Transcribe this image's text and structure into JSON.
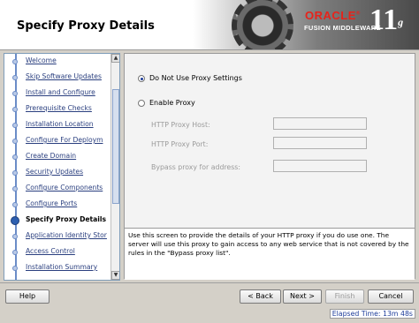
{
  "header": {
    "title": "Specify Proxy Details",
    "brand": "ORACLE",
    "brand_reg": "®",
    "product": "FUSION MIDDLEWARE",
    "version": "11",
    "version_suffix": "g"
  },
  "nav": {
    "items": [
      {
        "label": "Welcome",
        "state": "done"
      },
      {
        "label": "Skip Software Updates",
        "state": "done"
      },
      {
        "label": "Install and Configure",
        "state": "done"
      },
      {
        "label": "Prerequisite Checks",
        "state": "done"
      },
      {
        "label": "Installation Location",
        "state": "done"
      },
      {
        "label": "Configure For Deploym",
        "state": "done"
      },
      {
        "label": "Create Domain",
        "state": "done"
      },
      {
        "label": "Security Updates",
        "state": "done"
      },
      {
        "label": "Configure Components",
        "state": "done"
      },
      {
        "label": "Configure Ports",
        "state": "done"
      },
      {
        "label": "Specify Proxy Details",
        "state": "current"
      },
      {
        "label": "Application Identity Stor",
        "state": "future"
      },
      {
        "label": "Access Control",
        "state": "future"
      },
      {
        "label": "Installation Summary",
        "state": "future"
      }
    ]
  },
  "form": {
    "no_proxy_label": "Do Not Use Proxy Settings",
    "enable_proxy_label": "Enable Proxy",
    "selected": "no_proxy",
    "proxy_host_label": "HTTP Proxy Host:",
    "proxy_host_value": "",
    "proxy_port_label": "HTTP Proxy Port:",
    "proxy_port_value": "",
    "bypass_label": "Bypass proxy for address:",
    "bypass_value": ""
  },
  "help_text": "Use this screen to provide the details of your HTTP proxy if you do use one. The server will use this proxy to gain access to any web service that is not covered by the rules in the \"Bypass proxy list\".",
  "buttons": {
    "help": "Help",
    "back": "< Back",
    "next": "Next >",
    "finish": "Finish",
    "cancel": "Cancel"
  },
  "status": {
    "elapsed": "Elapsed Time: 13m 48s"
  }
}
